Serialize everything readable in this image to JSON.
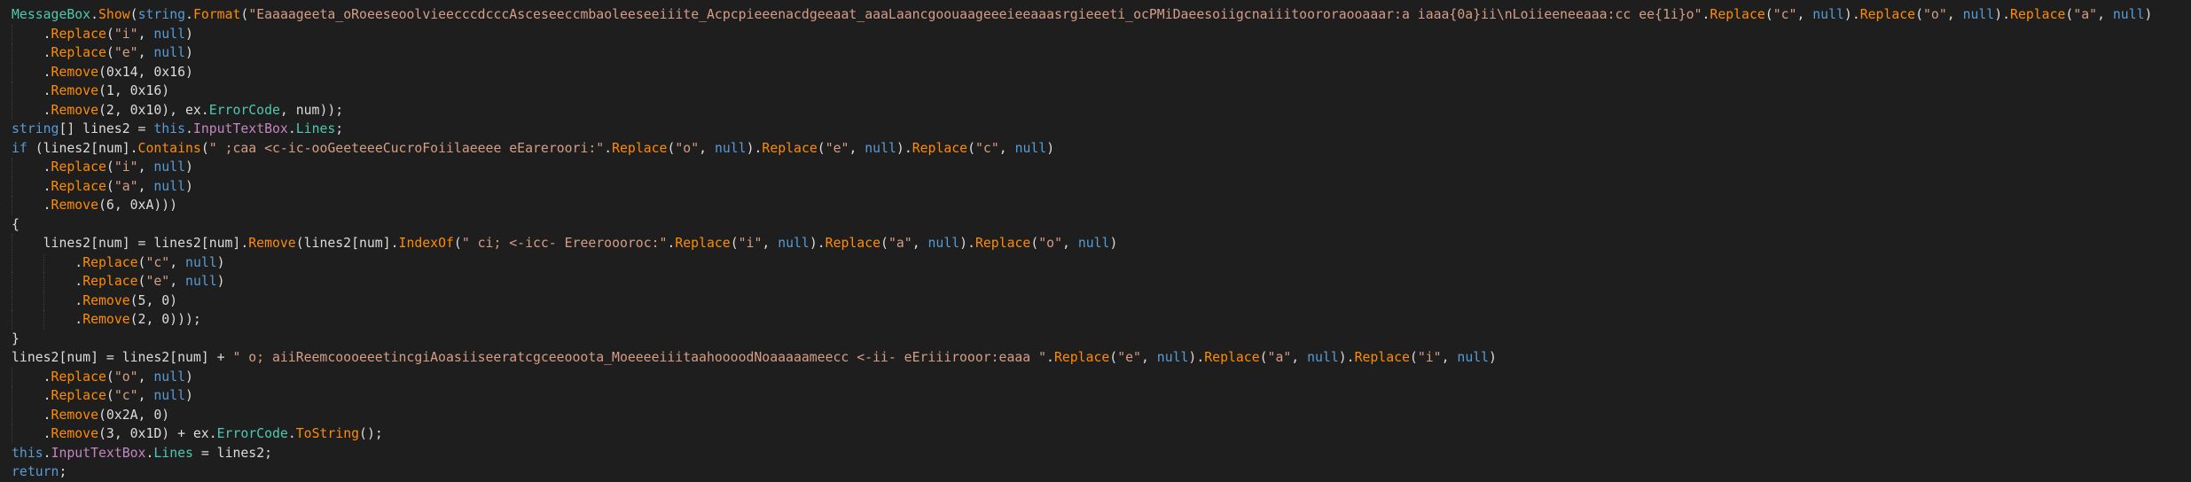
{
  "colors": {
    "background": "#1e1e1e",
    "type": "#4ec9b0",
    "keyword": "#569cd6",
    "method": "#ff8c00",
    "property": "#c586c0",
    "field": "#4ec9b0",
    "string": "#d69d85",
    "plain": "#dcdcdc",
    "indent_guide": "#3f3f3f"
  },
  "lines": [
    [
      {
        "k": "type",
        "t": "MessageBox"
      },
      {
        "k": "plain",
        "t": "."
      },
      {
        "k": "member",
        "t": "Show"
      },
      {
        "k": "plain",
        "t": "("
      },
      {
        "k": "kw",
        "t": "string"
      },
      {
        "k": "plain",
        "t": "."
      },
      {
        "k": "member",
        "t": "Format"
      },
      {
        "k": "plain",
        "t": "("
      },
      {
        "k": "str",
        "t": "\"Eaaaageeta_oRoeeseoolvieecccdcccAsceseeccmbaoleeseeiiite_Acpcpieeenacdgeeaat_aaaLaancgoouaageeeieeaaasrgieeeti_ocPMiDaeesoiigcnaiiitoororaooaaar:a iaaa{0a}ii\\nLoiieeneeaaa:cc ee{1i}o\""
      },
      {
        "k": "plain",
        "t": "."
      },
      {
        "k": "member",
        "t": "Replace"
      },
      {
        "k": "plain",
        "t": "("
      },
      {
        "k": "str",
        "t": "\"c\""
      },
      {
        "k": "plain",
        "t": ", "
      },
      {
        "k": "kw",
        "t": "null"
      },
      {
        "k": "plain",
        "t": ")."
      },
      {
        "k": "member",
        "t": "Replace"
      },
      {
        "k": "plain",
        "t": "("
      },
      {
        "k": "str",
        "t": "\"o\""
      },
      {
        "k": "plain",
        "t": ", "
      },
      {
        "k": "kw",
        "t": "null"
      },
      {
        "k": "plain",
        "t": ")."
      },
      {
        "k": "member",
        "t": "Replace"
      },
      {
        "k": "plain",
        "t": "("
      },
      {
        "k": "str",
        "t": "\"a\""
      },
      {
        "k": "plain",
        "t": ", "
      },
      {
        "k": "kw",
        "t": "null"
      },
      {
        "k": "plain",
        "t": ")"
      }
    ],
    [
      {
        "k": "plain",
        "t": "    ."
      },
      {
        "k": "member",
        "t": "Replace"
      },
      {
        "k": "plain",
        "t": "("
      },
      {
        "k": "str",
        "t": "\"i\""
      },
      {
        "k": "plain",
        "t": ", "
      },
      {
        "k": "kw",
        "t": "null"
      },
      {
        "k": "plain",
        "t": ")"
      }
    ],
    [
      {
        "k": "plain",
        "t": "    ."
      },
      {
        "k": "member",
        "t": "Replace"
      },
      {
        "k": "plain",
        "t": "("
      },
      {
        "k": "str",
        "t": "\"e\""
      },
      {
        "k": "plain",
        "t": ", "
      },
      {
        "k": "kw",
        "t": "null"
      },
      {
        "k": "plain",
        "t": ")"
      }
    ],
    [
      {
        "k": "plain",
        "t": "    ."
      },
      {
        "k": "member",
        "t": "Remove"
      },
      {
        "k": "plain",
        "t": "(0x14, 0x16)"
      }
    ],
    [
      {
        "k": "plain",
        "t": "    ."
      },
      {
        "k": "member",
        "t": "Remove"
      },
      {
        "k": "plain",
        "t": "(1, 0x16)"
      }
    ],
    [
      {
        "k": "plain",
        "t": "    ."
      },
      {
        "k": "member",
        "t": "Remove"
      },
      {
        "k": "plain",
        "t": "(2, 0x10), ex."
      },
      {
        "k": "field",
        "t": "ErrorCode"
      },
      {
        "k": "plain",
        "t": ", num));"
      }
    ],
    [
      {
        "k": "kw",
        "t": "string"
      },
      {
        "k": "plain",
        "t": "[] lines2 = "
      },
      {
        "k": "kw",
        "t": "this"
      },
      {
        "k": "plain",
        "t": "."
      },
      {
        "k": "prop",
        "t": "InputTextBox"
      },
      {
        "k": "plain",
        "t": "."
      },
      {
        "k": "field",
        "t": "Lines"
      },
      {
        "k": "plain",
        "t": ";"
      }
    ],
    [
      {
        "k": "kw",
        "t": "if"
      },
      {
        "k": "plain",
        "t": " (lines2[num]."
      },
      {
        "k": "member",
        "t": "Contains"
      },
      {
        "k": "plain",
        "t": "("
      },
      {
        "k": "str",
        "t": "\" ;caa <c-ic-ooGeeteeeCucroFoiilaeeee eEareroori:\""
      },
      {
        "k": "plain",
        "t": "."
      },
      {
        "k": "member",
        "t": "Replace"
      },
      {
        "k": "plain",
        "t": "("
      },
      {
        "k": "str",
        "t": "\"o\""
      },
      {
        "k": "plain",
        "t": ", "
      },
      {
        "k": "kw",
        "t": "null"
      },
      {
        "k": "plain",
        "t": ")."
      },
      {
        "k": "member",
        "t": "Replace"
      },
      {
        "k": "plain",
        "t": "("
      },
      {
        "k": "str",
        "t": "\"e\""
      },
      {
        "k": "plain",
        "t": ", "
      },
      {
        "k": "kw",
        "t": "null"
      },
      {
        "k": "plain",
        "t": ")."
      },
      {
        "k": "member",
        "t": "Replace"
      },
      {
        "k": "plain",
        "t": "("
      },
      {
        "k": "str",
        "t": "\"c\""
      },
      {
        "k": "plain",
        "t": ", "
      },
      {
        "k": "kw",
        "t": "null"
      },
      {
        "k": "plain",
        "t": ")"
      }
    ],
    [
      {
        "k": "plain",
        "t": "    ."
      },
      {
        "k": "member",
        "t": "Replace"
      },
      {
        "k": "plain",
        "t": "("
      },
      {
        "k": "str",
        "t": "\"i\""
      },
      {
        "k": "plain",
        "t": ", "
      },
      {
        "k": "kw",
        "t": "null"
      },
      {
        "k": "plain",
        "t": ")"
      }
    ],
    [
      {
        "k": "plain",
        "t": "    ."
      },
      {
        "k": "member",
        "t": "Replace"
      },
      {
        "k": "plain",
        "t": "("
      },
      {
        "k": "str",
        "t": "\"a\""
      },
      {
        "k": "plain",
        "t": ", "
      },
      {
        "k": "kw",
        "t": "null"
      },
      {
        "k": "plain",
        "t": ")"
      }
    ],
    [
      {
        "k": "plain",
        "t": "    ."
      },
      {
        "k": "member",
        "t": "Remove"
      },
      {
        "k": "plain",
        "t": "(6, 0xA)))"
      }
    ],
    [
      {
        "k": "plain",
        "t": "{"
      }
    ],
    [
      {
        "k": "plain",
        "t": "    lines2[num] = lines2[num]."
      },
      {
        "k": "member",
        "t": "Remove"
      },
      {
        "k": "plain",
        "t": "(lines2[num]."
      },
      {
        "k": "member",
        "t": "IndexOf"
      },
      {
        "k": "plain",
        "t": "("
      },
      {
        "k": "str",
        "t": "\" ci; <-icc- Ereeroooroc:\""
      },
      {
        "k": "plain",
        "t": "."
      },
      {
        "k": "member",
        "t": "Replace"
      },
      {
        "k": "plain",
        "t": "("
      },
      {
        "k": "str",
        "t": "\"i\""
      },
      {
        "k": "plain",
        "t": ", "
      },
      {
        "k": "kw",
        "t": "null"
      },
      {
        "k": "plain",
        "t": ")."
      },
      {
        "k": "member",
        "t": "Replace"
      },
      {
        "k": "plain",
        "t": "("
      },
      {
        "k": "str",
        "t": "\"a\""
      },
      {
        "k": "plain",
        "t": ", "
      },
      {
        "k": "kw",
        "t": "null"
      },
      {
        "k": "plain",
        "t": ")."
      },
      {
        "k": "member",
        "t": "Replace"
      },
      {
        "k": "plain",
        "t": "("
      },
      {
        "k": "str",
        "t": "\"o\""
      },
      {
        "k": "plain",
        "t": ", "
      },
      {
        "k": "kw",
        "t": "null"
      },
      {
        "k": "plain",
        "t": ")"
      }
    ],
    [
      {
        "k": "plain",
        "t": "        ."
      },
      {
        "k": "member",
        "t": "Replace"
      },
      {
        "k": "plain",
        "t": "("
      },
      {
        "k": "str",
        "t": "\"c\""
      },
      {
        "k": "plain",
        "t": ", "
      },
      {
        "k": "kw",
        "t": "null"
      },
      {
        "k": "plain",
        "t": ")"
      }
    ],
    [
      {
        "k": "plain",
        "t": "        ."
      },
      {
        "k": "member",
        "t": "Replace"
      },
      {
        "k": "plain",
        "t": "("
      },
      {
        "k": "str",
        "t": "\"e\""
      },
      {
        "k": "plain",
        "t": ", "
      },
      {
        "k": "kw",
        "t": "null"
      },
      {
        "k": "plain",
        "t": ")"
      }
    ],
    [
      {
        "k": "plain",
        "t": "        ."
      },
      {
        "k": "member",
        "t": "Remove"
      },
      {
        "k": "plain",
        "t": "(5, 0)"
      }
    ],
    [
      {
        "k": "plain",
        "t": "        ."
      },
      {
        "k": "member",
        "t": "Remove"
      },
      {
        "k": "plain",
        "t": "(2, 0)));"
      }
    ],
    [
      {
        "k": "plain",
        "t": "}"
      }
    ],
    [
      {
        "k": "plain",
        "t": "lines2[num] = lines2[num] + "
      },
      {
        "k": "str",
        "t": "\" o; aiiReemcoooeeetincgiAoasiiseeratcgceeooota_MoeeeeiiitaahoooodNoaaaaameecc <-ii- eEriiirooor:eaaa \""
      },
      {
        "k": "plain",
        "t": "."
      },
      {
        "k": "member",
        "t": "Replace"
      },
      {
        "k": "plain",
        "t": "("
      },
      {
        "k": "str",
        "t": "\"e\""
      },
      {
        "k": "plain",
        "t": ", "
      },
      {
        "k": "kw",
        "t": "null"
      },
      {
        "k": "plain",
        "t": ")."
      },
      {
        "k": "member",
        "t": "Replace"
      },
      {
        "k": "plain",
        "t": "("
      },
      {
        "k": "str",
        "t": "\"a\""
      },
      {
        "k": "plain",
        "t": ", "
      },
      {
        "k": "kw",
        "t": "null"
      },
      {
        "k": "plain",
        "t": ")."
      },
      {
        "k": "member",
        "t": "Replace"
      },
      {
        "k": "plain",
        "t": "("
      },
      {
        "k": "str",
        "t": "\"i\""
      },
      {
        "k": "plain",
        "t": ", "
      },
      {
        "k": "kw",
        "t": "null"
      },
      {
        "k": "plain",
        "t": ")"
      }
    ],
    [
      {
        "k": "plain",
        "t": "    ."
      },
      {
        "k": "member",
        "t": "Replace"
      },
      {
        "k": "plain",
        "t": "("
      },
      {
        "k": "str",
        "t": "\"o\""
      },
      {
        "k": "plain",
        "t": ", "
      },
      {
        "k": "kw",
        "t": "null"
      },
      {
        "k": "plain",
        "t": ")"
      }
    ],
    [
      {
        "k": "plain",
        "t": "    ."
      },
      {
        "k": "member",
        "t": "Replace"
      },
      {
        "k": "plain",
        "t": "("
      },
      {
        "k": "str",
        "t": "\"c\""
      },
      {
        "k": "plain",
        "t": ", "
      },
      {
        "k": "kw",
        "t": "null"
      },
      {
        "k": "plain",
        "t": ")"
      }
    ],
    [
      {
        "k": "plain",
        "t": "    ."
      },
      {
        "k": "member",
        "t": "Remove"
      },
      {
        "k": "plain",
        "t": "(0x2A, 0)"
      }
    ],
    [
      {
        "k": "plain",
        "t": "    ."
      },
      {
        "k": "member",
        "t": "Remove"
      },
      {
        "k": "plain",
        "t": "(3, 0x1D) + ex."
      },
      {
        "k": "field",
        "t": "ErrorCode"
      },
      {
        "k": "plain",
        "t": "."
      },
      {
        "k": "member",
        "t": "ToString"
      },
      {
        "k": "plain",
        "t": "();"
      }
    ],
    [
      {
        "k": "kw",
        "t": "this"
      },
      {
        "k": "plain",
        "t": "."
      },
      {
        "k": "prop",
        "t": "InputTextBox"
      },
      {
        "k": "plain",
        "t": "."
      },
      {
        "k": "field",
        "t": "Lines"
      },
      {
        "k": "plain",
        "t": " = lines2;"
      }
    ],
    [
      {
        "k": "kw",
        "t": "return"
      },
      {
        "k": "plain",
        "t": ";"
      }
    ]
  ]
}
